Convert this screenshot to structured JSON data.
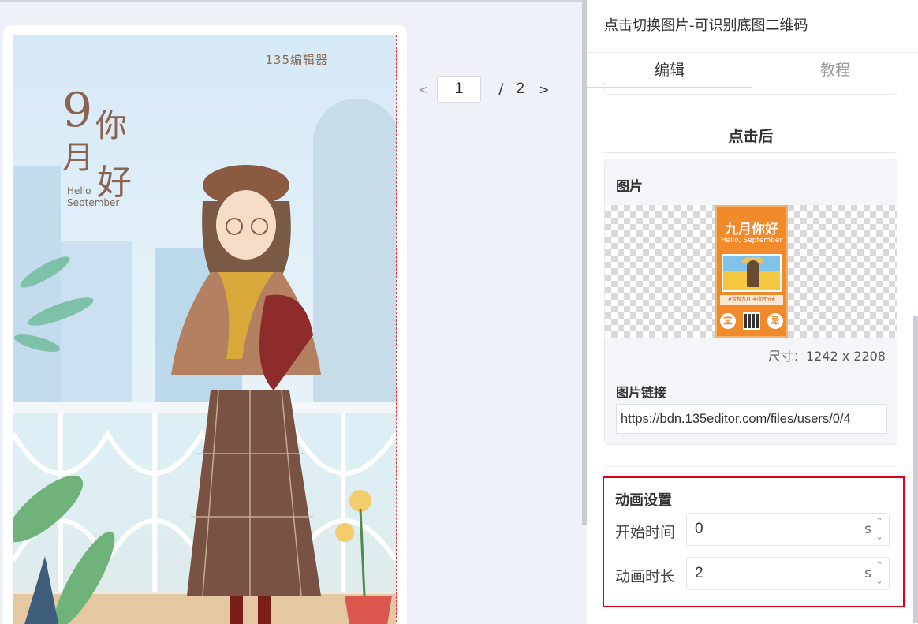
{
  "poster": {
    "brand": "135编辑器",
    "title_nine": "9",
    "title_ni": "你",
    "title_yue": "月",
    "title_hao": "好",
    "hello_line1": "Hello",
    "hello_line2": "September"
  },
  "pager": {
    "prev": "<",
    "current": "1",
    "separator": "/",
    "total": "2",
    "next": ">"
  },
  "panel": {
    "title": "点击切换图片-可识别底图二维码",
    "tabs": [
      {
        "label": "编辑",
        "active": true
      },
      {
        "label": "教程",
        "active": false
      }
    ],
    "section_heading": "点击后",
    "image": {
      "label": "图片",
      "thumb_title": "九月你好",
      "thumb_subtitle": "Hello, September",
      "thumb_banner": "#金秋九月 丰收时节#",
      "thumb_left": "宜",
      "thumb_right": "忌",
      "size_text": "尺寸：1242 x 2208"
    },
    "link": {
      "label": "图片链接",
      "value": "https://bdn.135editor.com/files/users/0/4"
    },
    "animation": {
      "title": "动画设置",
      "start_label": "开始时间",
      "start_value": "0",
      "duration_label": "动画时长",
      "duration_value": "2",
      "unit": "s",
      "up": "⌃",
      "down": "⌄"
    }
  },
  "colors": {
    "accent_red": "#d9001b",
    "tab_underline": "#ffc8bf",
    "thumb_orange": "#f08a2b"
  }
}
